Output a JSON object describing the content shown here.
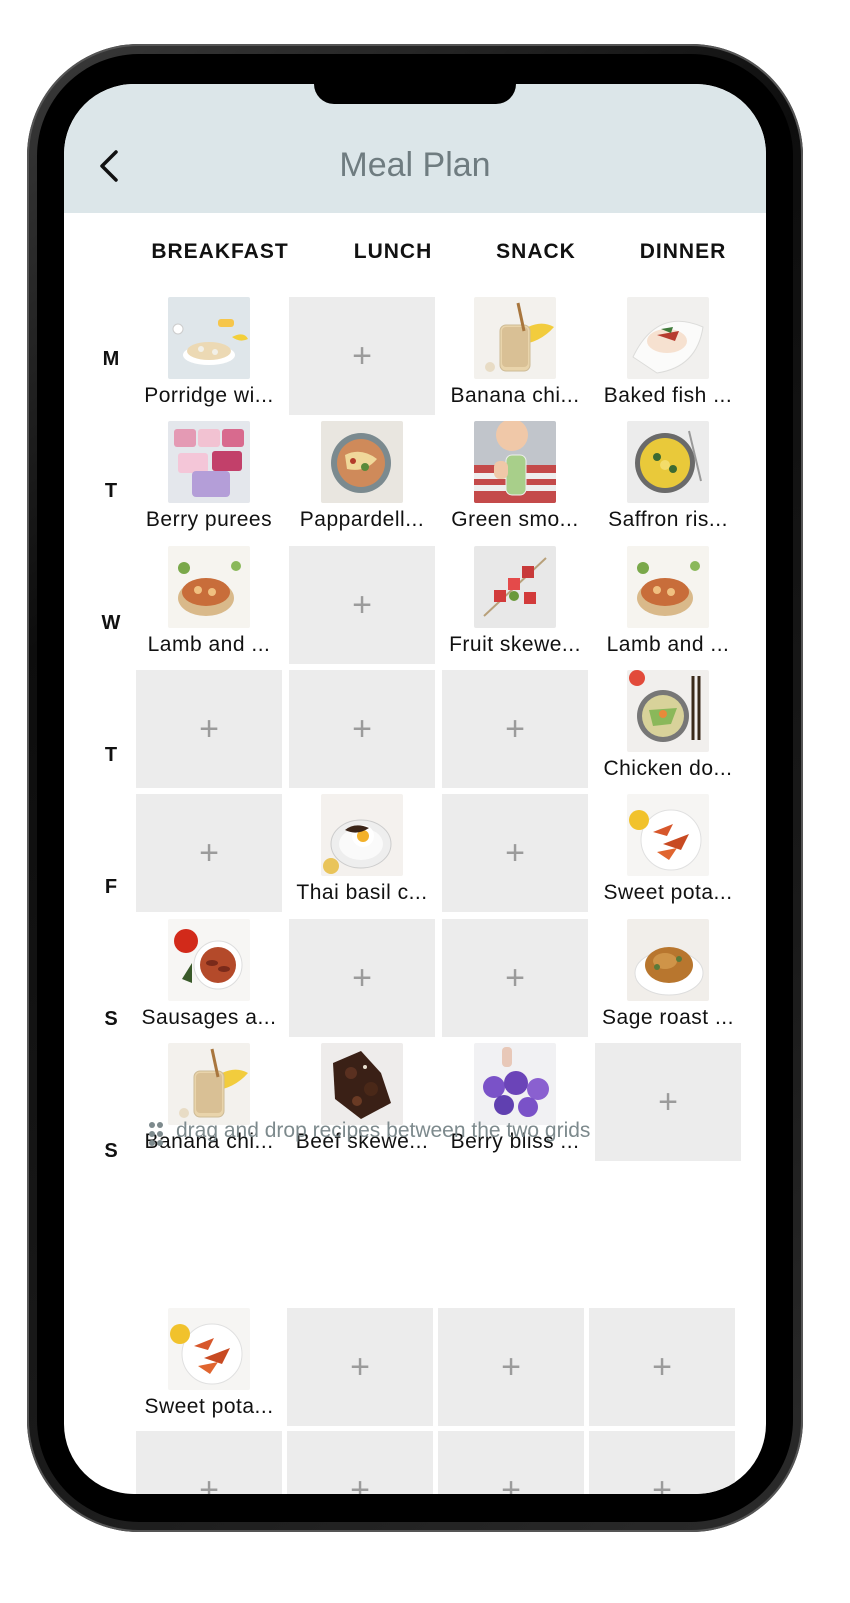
{
  "header": {
    "title": "Meal Plan",
    "back_icon": "chevron-left-icon"
  },
  "columns": [
    "BREAKFAST",
    "LUNCH",
    "SNACK",
    "DINNER"
  ],
  "days": [
    "M",
    "T",
    "W",
    "T",
    "F",
    "S",
    "S"
  ],
  "plan": [
    [
      {
        "label": "Porridge wi...",
        "img": "porridge"
      },
      null,
      {
        "label": "Banana chi...",
        "img": "banana-jar"
      },
      {
        "label": "Baked fish ...",
        "img": "baked-fish"
      }
    ],
    [
      {
        "label": "Berry purees",
        "img": "berry-purees"
      },
      {
        "label": "Pappardell...",
        "img": "pappardelle"
      },
      {
        "label": "Green smo...",
        "img": "green-smoothie"
      },
      {
        "label": "Saffron ris...",
        "img": "saffron-risotto"
      }
    ],
    [
      {
        "label": "Lamb and ...",
        "img": "lamb"
      },
      null,
      {
        "label": "Fruit skewe...",
        "img": "fruit-skewers"
      },
      {
        "label": "Lamb and ...",
        "img": "lamb"
      }
    ],
    [
      null,
      null,
      null,
      {
        "label": "Chicken do...",
        "img": "chicken-donburi"
      }
    ],
    [
      null,
      {
        "label": "Thai basil c...",
        "img": "thai-basil"
      },
      null,
      {
        "label": "Sweet pota...",
        "img": "sweet-potato"
      }
    ],
    [
      {
        "label": "Sausages a...",
        "img": "sausages"
      },
      null,
      null,
      {
        "label": "Sage roast ...",
        "img": "sage-roast"
      }
    ],
    [
      {
        "label": "Banana chi...",
        "img": "banana-jar"
      },
      {
        "label": "Beef skewe...",
        "img": "beef-skewers"
      },
      {
        "label": "Berry bliss ...",
        "img": "berry-bliss"
      },
      null
    ]
  ],
  "hint": {
    "icon": "drag-handle-icon",
    "text": "drag and drop recipes between the two grids"
  },
  "holding_grid": [
    [
      {
        "label": "Sweet pota...",
        "img": "sweet-potato"
      },
      null,
      null,
      null
    ],
    [
      null,
      null,
      null,
      null
    ]
  ],
  "add_symbol": "+",
  "colors": {
    "header_bg": "#dce6e9",
    "title": "#6f7c80",
    "empty_cell": "#ececec",
    "plus": "#9b9b9b"
  }
}
